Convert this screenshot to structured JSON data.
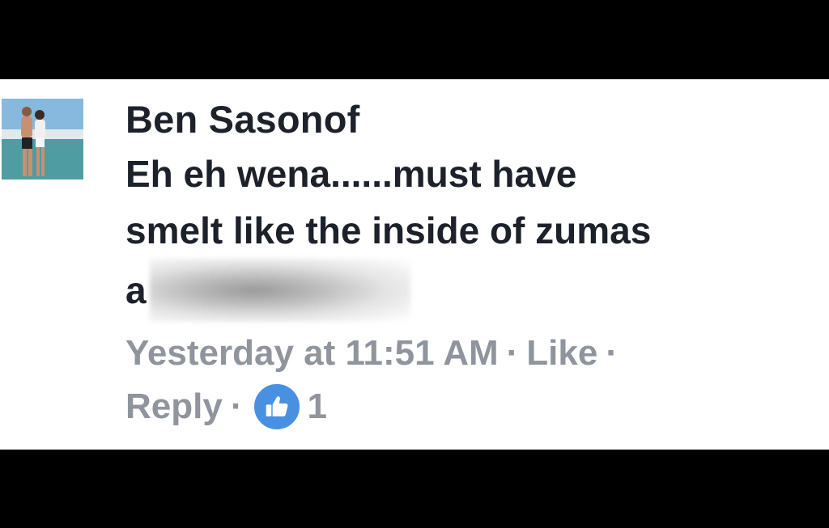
{
  "comment": {
    "author": "Ben Sasonof",
    "text": "Eh eh wena......must have\nsmelt like the inside of zumas",
    "redacted_visible_char": "a",
    "timestamp": "Yesterday at 11:51 AM",
    "like_label": "Like",
    "reply_label": "Reply",
    "separator": "·",
    "like_count": "1"
  },
  "colors": {
    "text_primary": "#1d2129",
    "text_meta": "#90949c",
    "like_badge": "#4a90e2",
    "card_background": "#ffffff",
    "frame_background": "#000000"
  },
  "icons": {
    "avatar": "profile-photo",
    "like_badge": "thumbs-up-icon"
  }
}
